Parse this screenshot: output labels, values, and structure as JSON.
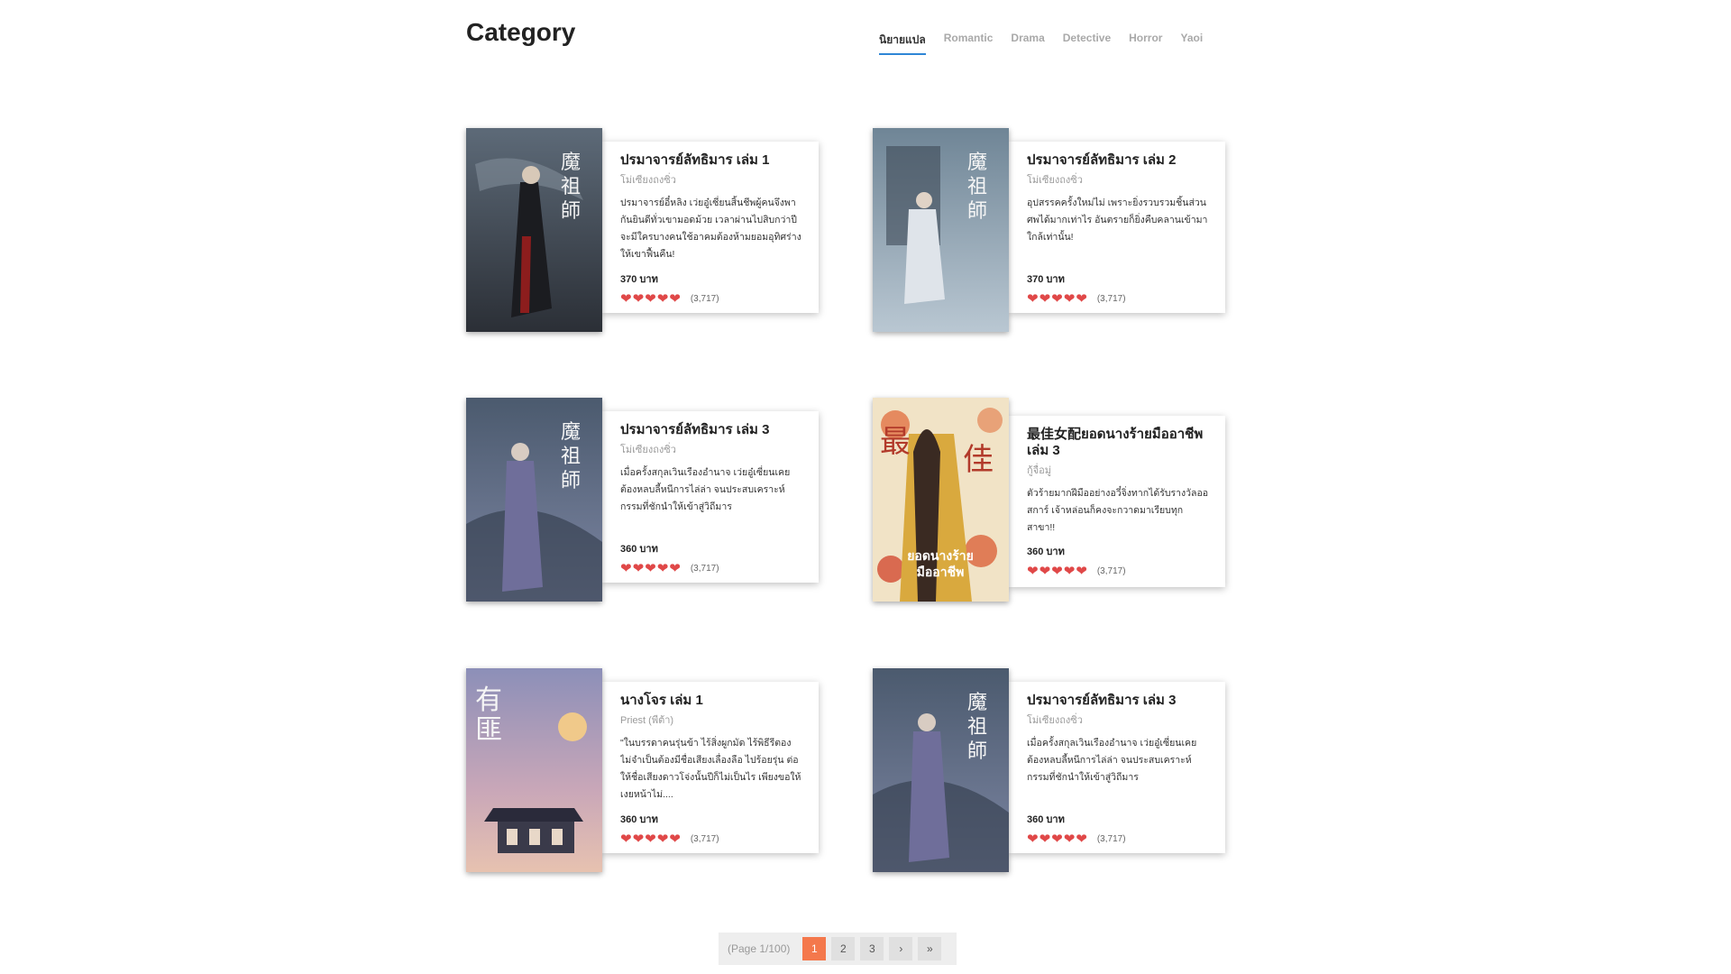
{
  "header": {
    "title": "Category",
    "tabs": [
      "นิยายแปล",
      "Romantic",
      "Drama",
      "Detective",
      "Horror",
      "Yaoi"
    ],
    "active_tab": "นิยายแปล"
  },
  "books": [
    {
      "title": "ปรมาจารย์ลัทธิมาร เล่ม 1",
      "author": "โม่เซียงถงซิ่ว",
      "description": "ปรมาจารย์อี๋หลิง เว่ยอู๋เซี่ยนสิ้นชีพผู้คนจึงพากันยินดีทั่วเขามอดม้วย เวลาผ่านไปสิบกว่าปีจะมีใครบางคนใช้อาคมต้องห้ามยอมอุทิศร่างให้เขาฟื้นคืน!",
      "price": "370 บาท",
      "hearts": "❤❤❤❤❤",
      "rating_count": "(3,717)",
      "cover_theme": "dark-blue-red"
    },
    {
      "title": "ปรมาจารย์ลัทธิมาร เล่ม 2",
      "author": "โม่เซียงถงซิ่ว",
      "description": "อุปสรรคครั้งใหม่ไม่ เพราะยิ่งรวบรวมชิ้นส่วนศพได้มากเท่าไร อันตรายก็ยิ่งคืบคลานเข้ามาใกล้เท่านั้น!",
      "price": "370 บาท",
      "hearts": "❤❤❤❤❤",
      "rating_count": "(3,717)",
      "cover_theme": "misty-blue"
    },
    {
      "title": "ปรมาจารย์ลัทธิมาร เล่ม 3",
      "author": "โม่เซียงถงซิ่ว",
      "description": "เมื่อครั้งสกุลเวินเรืองอำนาจ เว่ยอู๋เซี่ยนเคยต้องหลบลี้หนีการไล่ล่า จนประสบเคราะห์กรรมที่ชักนำให้เข้าสู่วิถีมาร",
      "price": "360 บาท",
      "hearts": "❤❤❤❤❤",
      "rating_count": "(3,717)",
      "cover_theme": "slate-blue"
    },
    {
      "title": "最佳女配ยอดนางร้ายมืออาชีพ  เล่ม 3",
      "author": "กู้จื่อมู่",
      "description": "ตัวร้ายมากฝีมืออย่างอวี๋จิ่งทากได้รับรางวัลออสการ์ เจ้าหล่อนก็คงจะกวาดมาเรียบทุกสาขา!!",
      "price": "360 บาท",
      "hearts": "❤❤❤❤❤",
      "rating_count": "(3,717)",
      "cover_theme": "floral-gold",
      "cover_text": [
        "最",
        "佳",
        "ยอดนางร้าย",
        "มืออาชีพ"
      ]
    },
    {
      "title": "นางโจร เล่ม 1",
      "author": "Priest (พีต้า)",
      "description": "\"ในบรรดาคนรุ่นข้า ไร้สิ่งผูกมัด ไร้พิธีรีตอง ไม่จำเป็นต้องมีชื่อเสียงเลื่องลือ ไปร้อยรุ่น ต่อให้ชื่อเสียงดาวโจ่งนั้นปีก็ไม่เป็นไร เพียงขอให้เงยหน้าไม่....",
      "price": "360 บาท",
      "hearts": "❤❤❤❤❤",
      "rating_count": "(3,717)",
      "cover_theme": "dusk-pink",
      "cover_text": [
        "有",
        "匪"
      ]
    },
    {
      "title": "ปรมาจารย์ลัทธิมาร เล่ม 3",
      "author": "โม่เซียงถงซิ่ว",
      "description": "เมื่อครั้งสกุลเวินเรืองอำนาจ เว่ยอู๋เซี่ยนเคยต้องหลบลี้หนีการไล่ล่า จนประสบเคราะห์กรรมที่ชักนำให้เข้าสู่วิถีมาร",
      "price": "360 บาท",
      "hearts": "❤❤❤❤❤",
      "rating_count": "(3,717)",
      "cover_theme": "slate-blue"
    }
  ],
  "pagination": {
    "info": "(Page 1/100)",
    "pages": [
      "1",
      "2",
      "3"
    ],
    "current_page": "1",
    "next": "›",
    "last": "»"
  },
  "colors": {
    "active_tab_underline": "#2f86d6",
    "active_page": "#f4784c",
    "heart": "#e04848"
  }
}
